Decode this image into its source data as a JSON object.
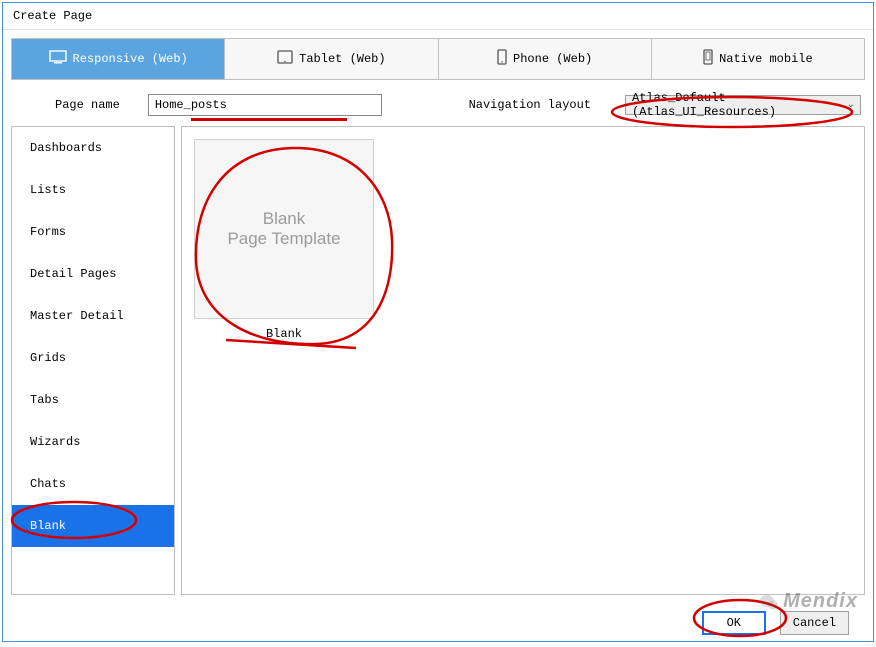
{
  "dialog": {
    "title": "Create Page"
  },
  "tabs": [
    {
      "label": "Responsive (Web)",
      "active": true
    },
    {
      "label": "Tablet (Web)",
      "active": false
    },
    {
      "label": "Phone (Web)",
      "active": false
    },
    {
      "label": "Native mobile",
      "active": false
    }
  ],
  "form": {
    "page_name_label": "Page name",
    "page_name_value": "Home_posts",
    "nav_layout_label": "Navigation layout",
    "nav_layout_value": "Atlas_Default (Atlas_UI_Resources)"
  },
  "sidebar": {
    "items": [
      {
        "label": "Dashboards",
        "selected": false
      },
      {
        "label": "Lists",
        "selected": false
      },
      {
        "label": "Forms",
        "selected": false
      },
      {
        "label": "Detail Pages",
        "selected": false
      },
      {
        "label": "Master Detail",
        "selected": false
      },
      {
        "label": "Grids",
        "selected": false
      },
      {
        "label": "Tabs",
        "selected": false
      },
      {
        "label": "Wizards",
        "selected": false
      },
      {
        "label": "Chats",
        "selected": false
      },
      {
        "label": "Blank",
        "selected": true
      }
    ]
  },
  "templates": [
    {
      "preview_line1": "Blank",
      "preview_line2": "Page Template",
      "label": "Blank"
    }
  ],
  "buttons": {
    "ok": "OK",
    "cancel": "Cancel"
  },
  "watermark": {
    "text": "Mendix"
  }
}
